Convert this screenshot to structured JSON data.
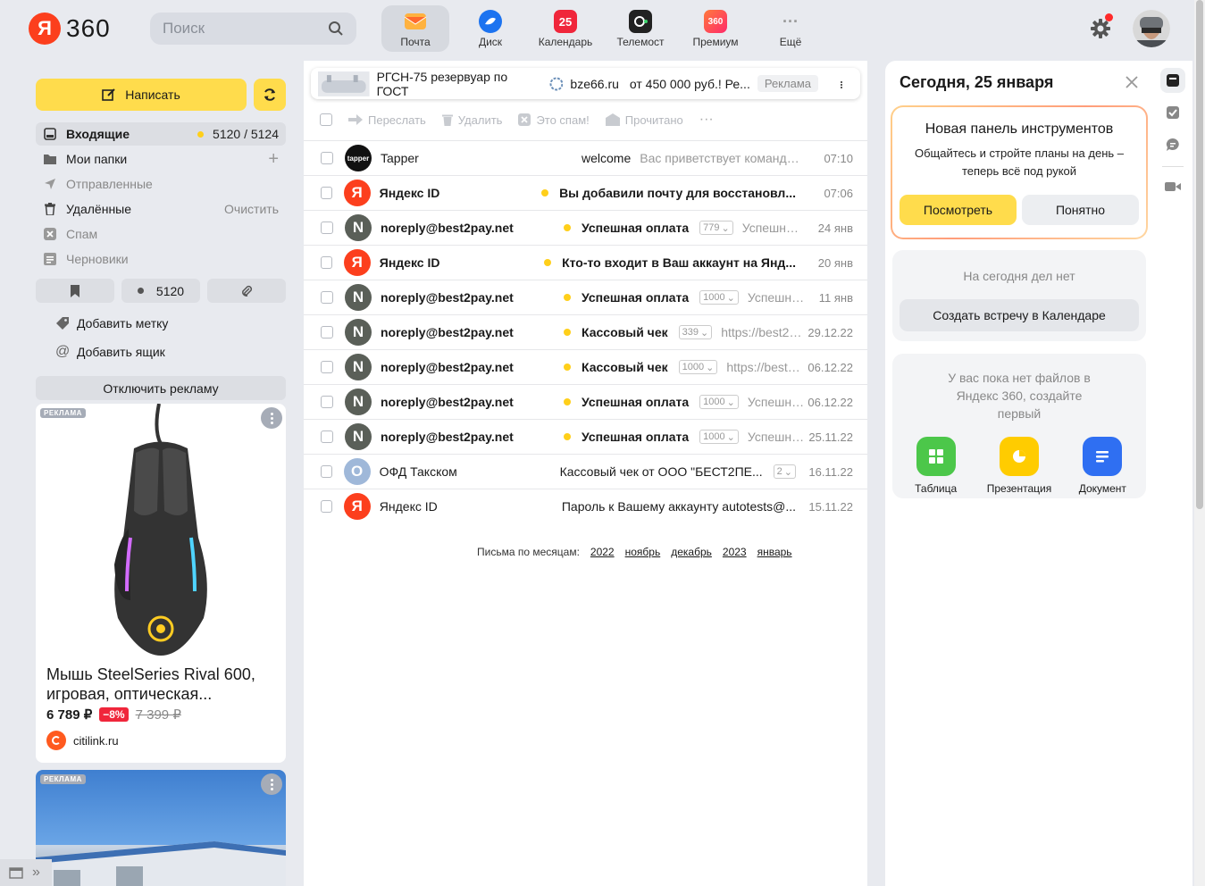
{
  "header": {
    "logo_letter": "Я",
    "logo_text": "360",
    "search_placeholder": "Поиск",
    "services": [
      {
        "label": "Почта",
        "icon": "mail-icon",
        "color": "#ff9b2f"
      },
      {
        "label": "Диск",
        "icon": "disk-icon",
        "color": "#1c73f0"
      },
      {
        "label": "Календарь",
        "icon": "calendar-icon",
        "badge": "25",
        "color": "#f0263b"
      },
      {
        "label": "Телемост",
        "icon": "telemost-icon",
        "color": "#222222"
      },
      {
        "label": "Премиум",
        "icon": "premium-icon",
        "badge": "360",
        "color": "#ff3b4e"
      },
      {
        "label": "Ещё",
        "icon": "more-icon"
      }
    ]
  },
  "sidebar": {
    "compose_label": "Написать",
    "folders": [
      {
        "label": "Входящие",
        "count": "5120 / 5124",
        "icon": "inbox-icon"
      },
      {
        "label": "Мои папки",
        "icon": "folder-icon"
      },
      {
        "label": "Отправленные",
        "icon": "sent-icon"
      },
      {
        "label": "Удалённые",
        "action": "Очистить",
        "icon": "trash-icon"
      },
      {
        "label": "Спам",
        "icon": "spam-icon"
      },
      {
        "label": "Черновики",
        "icon": "drafts-icon"
      }
    ],
    "unread_filter_count": "5120",
    "add_label": "Добавить метку",
    "add_mailbox": "Добавить ящик",
    "disable_ads": "Отключить рекламу"
  },
  "ad_card": {
    "badge": "РЕКЛАМА",
    "title": "Мышь SteelSeries Rival 600, игровая, оптическая...",
    "price": "6 789 ₽",
    "discount": "−8%",
    "old_price": "7 399 ₽",
    "store": "citilink.ru"
  },
  "ad_card2": {
    "badge": "РЕКЛАМА"
  },
  "ad_banner": {
    "title": "РГСН-75 резервуар по ГОСТ",
    "domain": "bze66.ru",
    "text": "от 450 000 руб.! Ре...",
    "label": "Реклама"
  },
  "toolbar": {
    "forward": "Переслать",
    "delete": "Удалить",
    "spam": "Это спам!",
    "read": "Прочитано"
  },
  "messages": [
    {
      "from": "Tapper",
      "avatar": "tapper",
      "color": "#111111",
      "subject": "welcome",
      "snippet": "Вас приветствует команда Ta...",
      "date": "07:10",
      "unread": false
    },
    {
      "from": "Яндекс ID",
      "avatar": "Я",
      "color": "#fc3f1d",
      "subject": "Вы добавили почту для восстановл...",
      "snippet": "",
      "date": "07:06",
      "unread": true
    },
    {
      "from": "noreply@best2pay.net",
      "avatar": "N",
      "color": "#5a5f58",
      "subject": "Успешная оплата",
      "count": "779",
      "snippet": "Успешная ...",
      "date": "24 янв",
      "unread": true
    },
    {
      "from": "Яндекс ID",
      "avatar": "Я",
      "color": "#fc3f1d",
      "subject": "Кто-то входит в Ваш аккаунт на Янд...",
      "snippet": "",
      "date": "20 янв",
      "unread": true
    },
    {
      "from": "noreply@best2pay.net",
      "avatar": "N",
      "color": "#5a5f58",
      "subject": "Успешная оплата",
      "count": "1000",
      "snippet": "Успешная...",
      "date": "11 янв",
      "unread": true
    },
    {
      "from": "noreply@best2pay.net",
      "avatar": "N",
      "color": "#5a5f58",
      "subject": "Кассовый чек",
      "count": "339",
      "snippet": "https://best2pa...",
      "date": "29.12.22",
      "unread": true
    },
    {
      "from": "noreply@best2pay.net",
      "avatar": "N",
      "color": "#5a5f58",
      "subject": "Кассовый чек",
      "count": "1000",
      "snippet": "https://best2p...",
      "date": "06.12.22",
      "unread": true
    },
    {
      "from": "noreply@best2pay.net",
      "avatar": "N",
      "color": "#5a5f58",
      "subject": "Успешная оплата",
      "count": "1000",
      "snippet": "Успешна...",
      "date": "06.12.22",
      "unread": true
    },
    {
      "from": "noreply@best2pay.net",
      "avatar": "N",
      "color": "#5a5f58",
      "subject": "Успешная оплата",
      "count": "1000",
      "snippet": "Успешна...",
      "date": "25.11.22",
      "unread": true
    },
    {
      "from": "ОФД Такском",
      "avatar": "О",
      "color": "#9fb8d9",
      "subject": "Кассовый чек от ООО \"БЕСТ2ПЕ...",
      "count": "2",
      "snippet": "",
      "date": "16.11.22",
      "unread": false
    },
    {
      "from": "Яндекс ID",
      "avatar": "Я",
      "color": "#fc3f1d",
      "subject": "Пароль к Вашему аккаунту autotests@...",
      "snippet": "",
      "date": "15.11.22",
      "unread": false
    }
  ],
  "months": {
    "label": "Письма по месяцам:",
    "links": [
      "2022",
      "ноябрь",
      "декабрь",
      "2023",
      "январь"
    ]
  },
  "right_panel": {
    "title": "Сегодня, 25 января",
    "promo_title": "Новая панель инструментов",
    "promo_text": "Общайтесь и стройте планы на день – теперь всё под рукой",
    "promo_view": "Посмотреть",
    "promo_ok": "Понятно",
    "no_tasks": "На сегодня дел нет",
    "create_meeting": "Создать встречу в Календаре",
    "no_files": "У вас пока нет файлов в Яндекс 360, создайте первый",
    "apps": [
      {
        "label": "Таблица",
        "color": "#4cc74a"
      },
      {
        "label": "Презентация",
        "color": "#ffcc00"
      },
      {
        "label": "Документ",
        "color": "#2f6ff2"
      }
    ]
  }
}
